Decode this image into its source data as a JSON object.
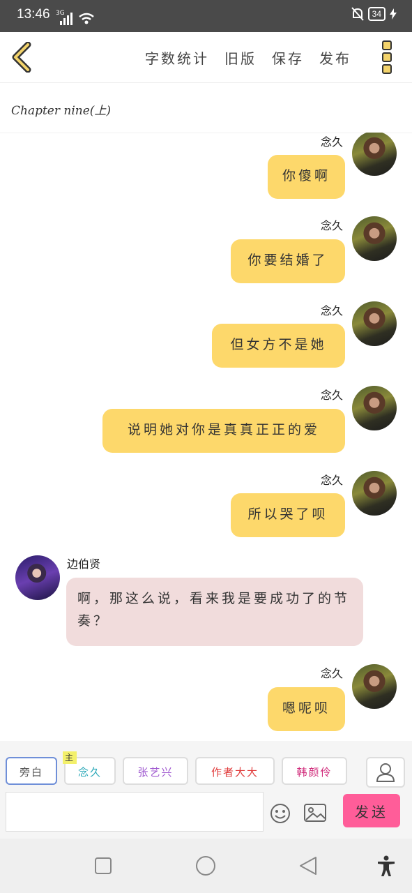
{
  "status": {
    "time": "13:46",
    "network": "3G",
    "battery": "34"
  },
  "toolbar": {
    "word_count": "字数统计",
    "old_version": "旧版",
    "save": "保存",
    "publish": "发布"
  },
  "chapter": {
    "title": "Chapter nine(上)"
  },
  "messages": [
    {
      "side": "right",
      "name": "念久",
      "text": "你傻啊"
    },
    {
      "side": "right",
      "name": "念久",
      "text": "你要结婚了"
    },
    {
      "side": "right",
      "name": "念久",
      "text": "但女方不是她"
    },
    {
      "side": "right",
      "name": "念久",
      "text": "说明她对你是真真正正的爱"
    },
    {
      "side": "right",
      "name": "念久",
      "text": "所以哭了呗"
    },
    {
      "side": "left",
      "name": "边伯贤",
      "text": "啊，那这么说，看来我是要成功了的节奏？"
    },
    {
      "side": "right",
      "name": "念久",
      "text": "嗯呢呗"
    }
  ],
  "roles": [
    {
      "label": "旁白",
      "color": "#555555"
    },
    {
      "label": "念久",
      "color": "#2aa8b8",
      "badge": "主"
    },
    {
      "label": "张艺兴",
      "color": "#a05ad0"
    },
    {
      "label": "作者大大",
      "color": "#e03a3a"
    },
    {
      "label": "韩颜伶",
      "color": "#d02a7a"
    }
  ],
  "composer": {
    "placeholder": "",
    "send_label": "发送"
  },
  "colors": {
    "bubble_self": "#fdd86b",
    "bubble_other": "#f1dcdc",
    "send": "#ff5d99",
    "role_active": "#6f8fd8"
  },
  "icons": [
    "back-arrow-icon",
    "menu-icon",
    "emoji-icon",
    "image-icon",
    "person-icon",
    "square-icon",
    "circle-icon",
    "triangle-back-icon",
    "accessibility-icon"
  ]
}
